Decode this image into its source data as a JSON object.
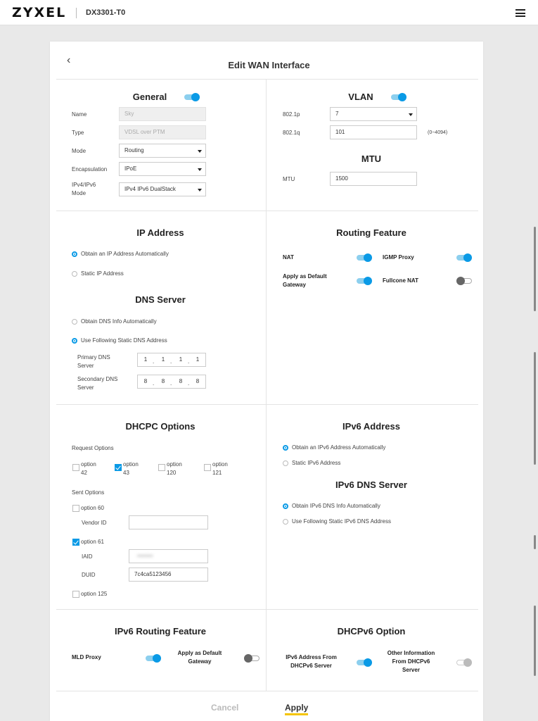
{
  "header": {
    "logo": "ZYXEL",
    "model": "DX3301-T0"
  },
  "modal": {
    "title": "Edit WAN Interface"
  },
  "general": {
    "title": "General",
    "enabled": true,
    "name_label": "Name",
    "name_value": "Sky",
    "type_label": "Type",
    "type_value": "VDSL over PTM",
    "mode_label": "Mode",
    "mode_value": "Routing",
    "encap_label": "Encapsulation",
    "encap_value": "IPoE",
    "ipmode_label_1": "IPv4/IPv6",
    "ipmode_label_2": "Mode",
    "ipmode_value": "IPv4 IPv6 DualStack"
  },
  "vlan": {
    "title": "VLAN",
    "enabled": true,
    "p_label": "802.1p",
    "p_value": "7",
    "q_label": "802.1q",
    "q_value": "101",
    "q_range": "(0~4094)"
  },
  "mtu": {
    "title": "MTU",
    "label": "MTU",
    "value": "1500"
  },
  "ip_address": {
    "title": "IP Address",
    "auto_label": "Obtain an IP Address Automatically",
    "static_label": "Static IP Address",
    "selected": "auto"
  },
  "dns_server": {
    "title": "DNS Server",
    "auto_label": "Obtain DNS Info Automatically",
    "static_label": "Use Following Static DNS Address",
    "selected": "static",
    "primary_label_1": "Primary DNS",
    "primary_label_2": "Server",
    "primary": [
      "1",
      "1",
      "1",
      "1"
    ],
    "secondary_label_1": "Secondary DNS",
    "secondary_label_2": "Server",
    "secondary": [
      "8",
      "8",
      "8",
      "8"
    ]
  },
  "routing_feature": {
    "title": "Routing Feature",
    "nat_label": "NAT",
    "nat": true,
    "igmp_label": "IGMP Proxy",
    "igmp": true,
    "gateway_label_1": "Apply as Default",
    "gateway_label_2": "Gateway",
    "gateway": true,
    "fullcone_label": "Fullcone NAT",
    "fullcone": false
  },
  "dhcpc": {
    "title": "DHCPC Options",
    "request_label": "Request Options",
    "request_options": [
      {
        "l1": "option",
        "l2": "42",
        "checked": false
      },
      {
        "l1": "option",
        "l2": "43",
        "checked": true
      },
      {
        "l1": "option",
        "l2": "120",
        "checked": false
      },
      {
        "l1": "option",
        "l2": "121",
        "checked": false
      }
    ],
    "sent_label": "Sent Options",
    "opt60_label": "option 60",
    "opt60": false,
    "vendor_label": "Vendor ID",
    "vendor_value": "",
    "opt61_label": "option 61",
    "opt61": true,
    "iaid_label": "IAID",
    "iaid_value": "••••••••",
    "duid_label": "DUID",
    "duid_value": "7c4ca5123456",
    "opt125_label": "option 125",
    "opt125": false
  },
  "ipv6_address": {
    "title": "IPv6 Address",
    "auto_label": "Obtain an IPv6 Address Automatically",
    "static_label": "Static IPv6 Address",
    "selected": "auto"
  },
  "ipv6_dns": {
    "title": "IPv6 DNS Server",
    "auto_label": "Obtain IPv6 DNS Info Automatically",
    "static_label": "Use Following Static IPv6 DNS Address",
    "selected": "auto"
  },
  "ipv6_routing": {
    "title": "IPv6 Routing Feature",
    "mld_label": "MLD Proxy",
    "mld": true,
    "gateway_label_1": "Apply as Default",
    "gateway_label_2": "Gateway",
    "gateway": false
  },
  "dhcpv6": {
    "title": "DHCPv6 Option",
    "addr_label_1": "IPv6 Address From",
    "addr_label_2": "DHCPv6 Server",
    "addr": true,
    "other_label_1": "Other Information",
    "other_label_2": "From DHCPv6",
    "other_label_3": "Server",
    "other": true
  },
  "actions": {
    "cancel": "Cancel",
    "apply": "Apply"
  },
  "colors": {
    "accent": "#0a9ae6",
    "apply_underline": "#f5c400"
  },
  "icons": {
    "back": "chevron-left-icon",
    "menu": "hamburger-menu-icon"
  }
}
